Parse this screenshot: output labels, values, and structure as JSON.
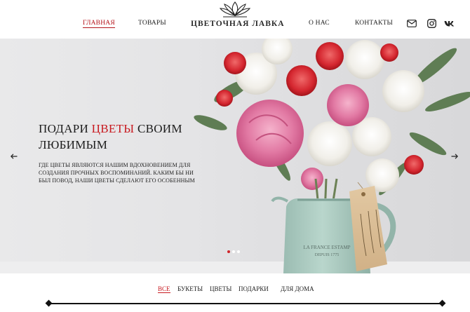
{
  "nav": {
    "home": "ГЛАВНАЯ",
    "products": "ТОВАРЫ",
    "about": "О НАС",
    "contacts": "КОНТАКТЫ"
  },
  "logo": {
    "text": "ЦВЕТОЧНАЯ ЛАВКА"
  },
  "header_icons": [
    "mail-icon",
    "instagram-icon",
    "vk-icon"
  ],
  "hero": {
    "title_part1": "ПОДАРИ ",
    "title_accent": "ЦВЕТЫ",
    "title_part2": " СВОИМ ЛЮБИМЫМ",
    "text": "ГДЕ ЦВЕТЫ ЯВЛЯЮТСЯ НАШИМ ВДОХНОВЕНИЕМ ДЛЯ СОЗДАНИЯ ПРОЧНЫХ ВОСПОМИНАНИЙ. КАКИМ БЫ НИ БЫЛ ПОВОД, НАШИ ЦВЕТЫ СДЕЛАЮТ ЕГО ОСОБЕННЫМ",
    "slides_total": 3,
    "active_slide": 1,
    "jug_label": "LA FRANCE ESTAMP DEPUIS 1775"
  },
  "tabs": [
    "ВСЕ",
    "БУКЕТЫ",
    "ЦВЕТЫ",
    "ПОДАРКИ",
    "ДЛЯ ДОМА"
  ],
  "colors": {
    "accent": "#c81a20",
    "text": "#1a1a1a",
    "jug": "#a9c9bf"
  }
}
